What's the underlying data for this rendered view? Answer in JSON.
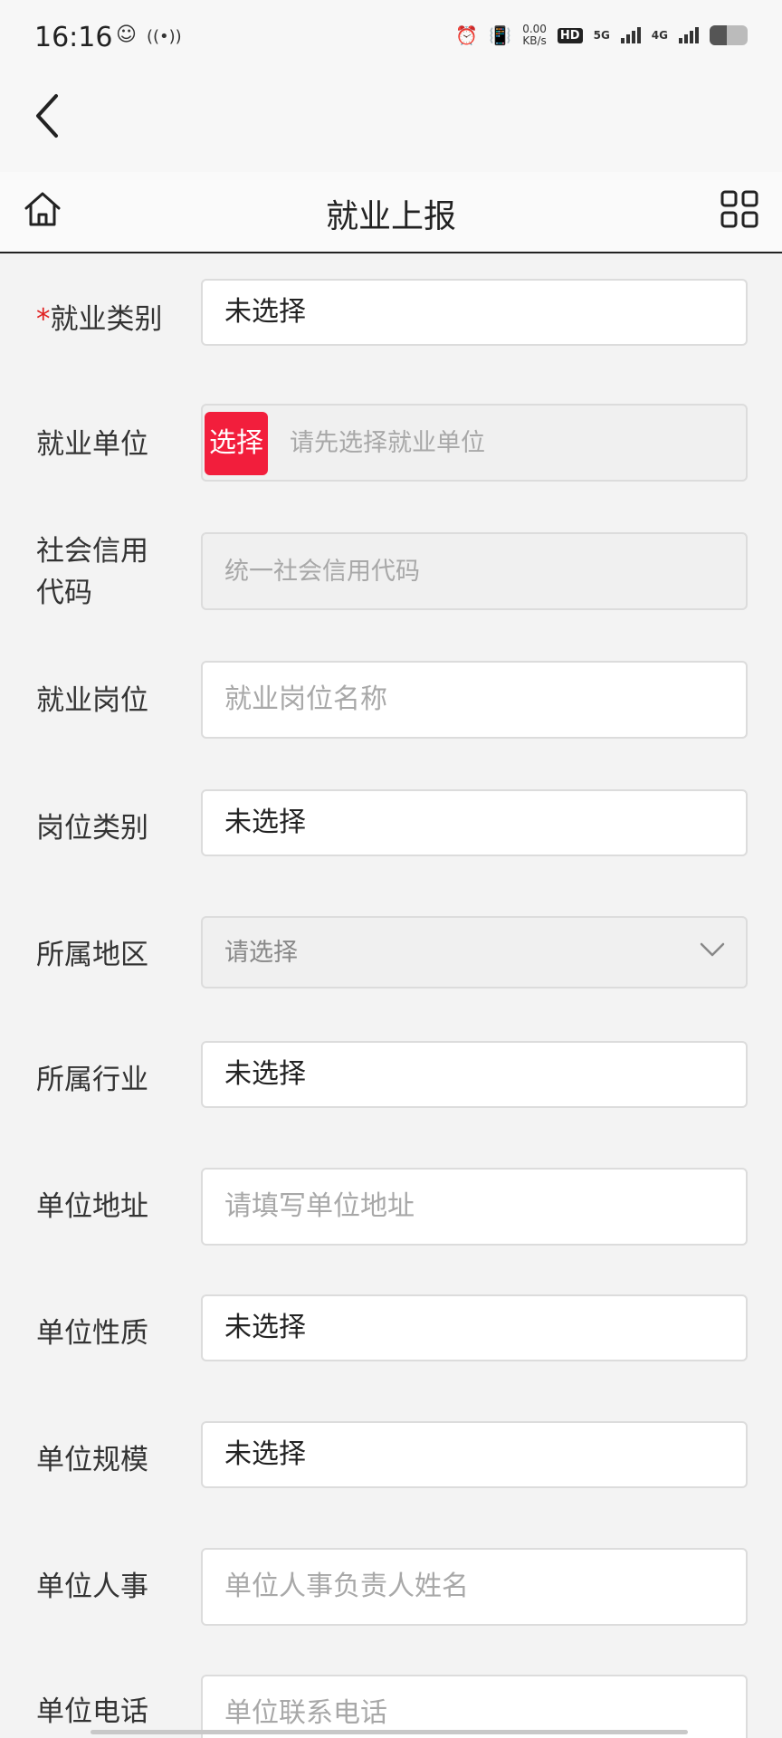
{
  "status_bar": {
    "time": "16:16",
    "net_speed": "0.00",
    "net_unit": "KB/s",
    "hd": "HD",
    "sim1_net": "5G",
    "sim2_net": "4G"
  },
  "header": {
    "title": "就业上报"
  },
  "form": {
    "employment_category": {
      "label": "就业类别",
      "required_mark": "*",
      "value": "未选择"
    },
    "employer": {
      "label": "就业单位",
      "button": "选择",
      "placeholder": "请先选择就业单位"
    },
    "credit_code": {
      "label_line1": "社会信用",
      "label_line2": "代码",
      "placeholder": "统一社会信用代码"
    },
    "position": {
      "label": "就业岗位",
      "placeholder": "就业岗位名称"
    },
    "position_category": {
      "label": "岗位类别",
      "value": "未选择"
    },
    "region": {
      "label": "所属地区",
      "value": "请选择"
    },
    "industry": {
      "label": "所属行业",
      "value": "未选择"
    },
    "address": {
      "label": "单位地址",
      "placeholder": "请填写单位地址"
    },
    "nature": {
      "label": "单位性质",
      "value": "未选择"
    },
    "scale": {
      "label": "单位规模",
      "value": "未选择"
    },
    "hr_contact": {
      "label": "单位人事",
      "placeholder": "单位人事负责人姓名"
    },
    "phone": {
      "label": "单位电话",
      "placeholder": "单位联系电话"
    }
  },
  "colors": {
    "accent_red": "#f21e3c",
    "required_red": "#e02020",
    "background": "#f3f3f3"
  }
}
